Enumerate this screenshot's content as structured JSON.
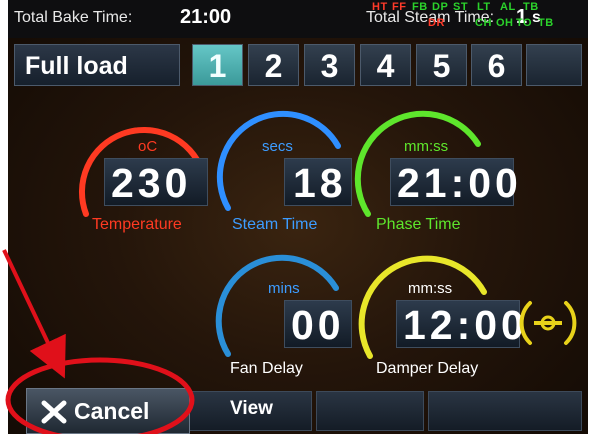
{
  "topbar": {
    "bake_label": "Total Bake Time:",
    "bake_value": "21:00",
    "steam_label": "Total Steam Time:",
    "steam_value": "1",
    "steam_unit": "s",
    "flags_row1": [
      {
        "code": "HT",
        "color": "#ff3b2a"
      },
      {
        "code": "FF",
        "color": "#ff3b2a"
      },
      {
        "code": "FB",
        "color": "#2bd12b"
      },
      {
        "code": "DP",
        "color": "#2bd12b"
      },
      {
        "code": "ST",
        "color": "#2bd12b"
      },
      {
        "code": "LT",
        "color": "#2bd12b"
      },
      {
        "code": "AL",
        "color": "#2bd12b"
      },
      {
        "code": "TB",
        "color": "#2bd12b"
      }
    ],
    "flags_row2": [
      {
        "code": "DR",
        "color": "#ff3b2a"
      },
      {
        "code": "CH",
        "color": "#2bd12b"
      },
      {
        "code": "OH",
        "color": "#2bd12b"
      },
      {
        "code": "TO",
        "color": "#2bd12b"
      },
      {
        "code": "TB",
        "color": "#2bd12b"
      }
    ]
  },
  "program": {
    "title": "Full load",
    "phases": [
      "1",
      "2",
      "3",
      "4",
      "5",
      "6"
    ],
    "active_phase": "1"
  },
  "gauges": {
    "temperature": {
      "unit": "oC",
      "value": "230",
      "label": "Temperature",
      "color": "#ff3a22"
    },
    "steam_time": {
      "unit": "secs",
      "value": "18",
      "label": "Steam Time",
      "color": "#2f8fff"
    },
    "phase_time": {
      "unit": "mm:ss",
      "value": "21:00",
      "label": "Phase Time",
      "color": "#5ee62c"
    },
    "fan_delay": {
      "unit": "mins",
      "value": "00",
      "label": "Fan Delay",
      "color": "#2a8fd8"
    },
    "damper_delay": {
      "unit": "mm:ss",
      "value": "12:00",
      "label": "Damper Delay",
      "color": "#e8e62a"
    }
  },
  "bottom": {
    "cancel_label": "Cancel",
    "view_label": "View"
  },
  "colors": {
    "label_white": "#ffffff",
    "active_tab": "#52b8b8",
    "annotation_red": "#e0101a",
    "damper_icon": "#e8d21a"
  },
  "icons": {
    "cancel": "close-x-icon",
    "damper": "damper-valve-icon"
  }
}
